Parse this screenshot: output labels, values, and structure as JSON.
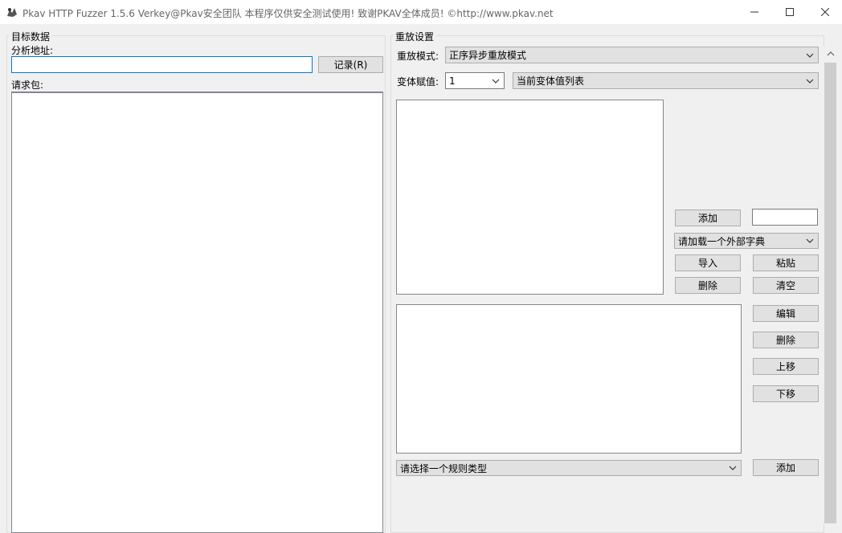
{
  "window": {
    "title": "Pkav HTTP Fuzzer 1.5.6  Verkey@Pkav安全团队  本程序仅供安全测试使用!  致谢PKAV全体成员! ©http://www.pkav.net"
  },
  "target": {
    "group_title": "目标数据",
    "address_label": "分析地址:",
    "address_value": "",
    "record_button": "记录(R)",
    "request_label": "请求包:",
    "request_value": ""
  },
  "replay": {
    "group_title": "重放设置",
    "mode_label": "重放模式:",
    "mode_value": "正序异步重放模式",
    "variant_label": "变体赋值:",
    "variant_value": "1",
    "variant_list_value": "当前变体值列表",
    "add_button": "添加",
    "add_input_value": "",
    "dict_value": "请加载一个外部字典",
    "import_button": "导入",
    "paste_button": "粘贴",
    "delete_button": "删除",
    "clear_button": "清空",
    "edit_button": "编辑",
    "rule_delete_button": "删除",
    "move_up_button": "上移",
    "move_down_button": "下移",
    "rule_type_value": "请选择一个规则类型",
    "rule_add_button": "添加"
  }
}
